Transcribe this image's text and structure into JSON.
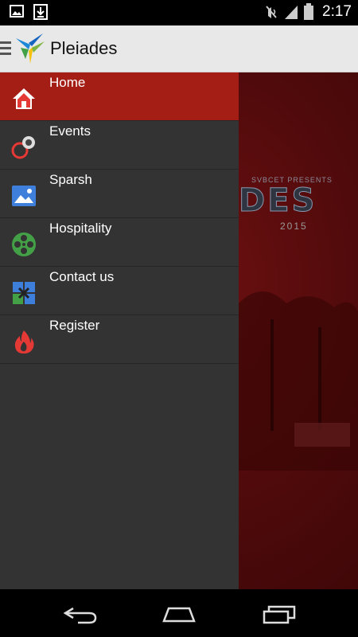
{
  "status_bar": {
    "time": "2:17",
    "left_icons": [
      "image-icon",
      "download-icon"
    ],
    "right_icons": [
      "mute-icon",
      "signal-icon",
      "battery-icon"
    ]
  },
  "action_bar": {
    "title": "Pleiades"
  },
  "background": {
    "presents": "SVBCET PRESENTS",
    "title": "DES",
    "year": "2015"
  },
  "drawer": {
    "items": [
      {
        "label": "Home",
        "icon": "home-icon",
        "active": true
      },
      {
        "label": "Events",
        "icon": "events-icon"
      },
      {
        "label": "Sparsh",
        "icon": "picture-icon"
      },
      {
        "label": "Hospitality",
        "icon": "film-reel-icon"
      },
      {
        "label": "Contact us",
        "icon": "contact-icon"
      },
      {
        "label": "Register",
        "icon": "flame-icon"
      }
    ]
  },
  "colors": {
    "active_item": "#a51e16",
    "drawer_bg": "#333333",
    "action_bar_bg": "#e8e8e8"
  },
  "nav_bar": {
    "buttons": [
      "back-icon",
      "home-icon",
      "recents-icon"
    ]
  }
}
